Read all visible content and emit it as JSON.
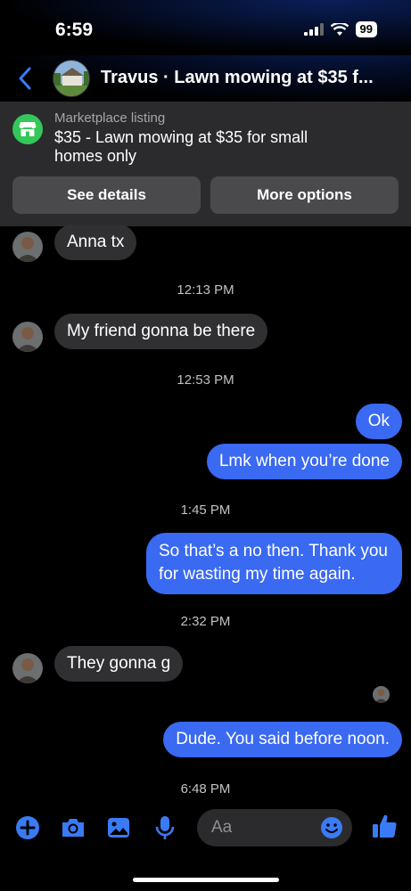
{
  "status": {
    "time": "6:59",
    "battery": "99"
  },
  "header": {
    "title": "Travus · Lawn mowing at $35 f..."
  },
  "listing": {
    "label": "Marketplace listing",
    "text": "$35 - Lawn mowing at $35 for small homes only",
    "see_details": "See details",
    "more_options": "More options"
  },
  "messages": {
    "m1": "Anna tx",
    "t1": "12:13 PM",
    "m2": "My friend gonna be there",
    "t2": "12:53 PM",
    "m3": "Ok",
    "m4": "Lmk when you’re done",
    "t3": "1:45 PM",
    "m5a": "So that’s a no then. Thank you",
    "m5b": "for wasting my time again.",
    "t4": "2:32 PM",
    "m6": "They gonna g",
    "m7": "Dude. You said before noon.",
    "t5": "6:48 PM"
  },
  "composer": {
    "placeholder": "Aa"
  },
  "colors": {
    "accent": "#3a69f2",
    "incoming": "#303032",
    "listing_bg": "#2b2b2d",
    "marketplace_green": "#34c759"
  }
}
